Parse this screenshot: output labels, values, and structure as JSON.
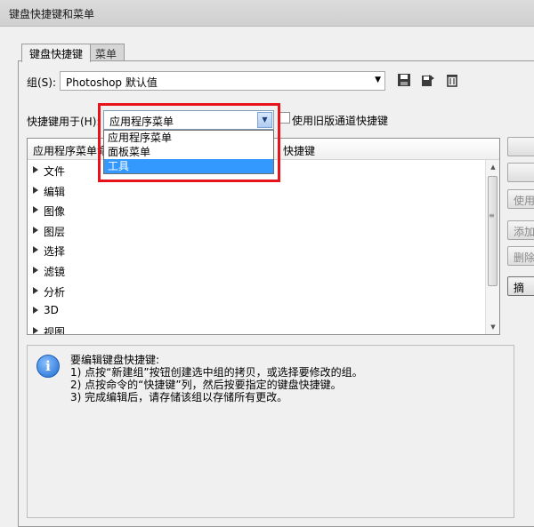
{
  "window": {
    "title": "键盘快捷键和菜单"
  },
  "tabs": [
    {
      "label": "键盘快捷键"
    },
    {
      "label": "菜单"
    }
  ],
  "group": {
    "label": "组(S):",
    "value": "Photoshop 默认值"
  },
  "shortcuts_for": {
    "label": "快捷键用于(H):",
    "value": "应用程序菜单",
    "options": [
      "应用程序菜单",
      "面板菜单",
      "工具"
    ],
    "selected": "工具"
  },
  "legacy_checkbox": {
    "label": "使用旧版通道快捷键"
  },
  "table": {
    "headers": [
      "应用程序菜单命",
      "快捷键"
    ],
    "rows": [
      "文件",
      "编辑",
      "图像",
      "图层",
      "选择",
      "滤镜",
      "分析",
      "3D",
      "视图"
    ]
  },
  "right_buttons": [
    "",
    "",
    "使用",
    "添加",
    "删除",
    "摘"
  ],
  "info": {
    "lines": [
      "要编辑键盘快捷键:",
      "1) 点按“新建组”按钮创建选中组的拷贝，或选择要修改的组。",
      "2) 点按命令的“快捷键”列，然后按要指定的键盘快捷键。",
      "3) 完成编辑后，请存储该组以存储所有更改。"
    ]
  },
  "icons": [
    "save-icon",
    "save-as-icon",
    "delete-icon",
    "info-icon"
  ],
  "colors": {
    "highlight_box": "#e8121b",
    "selected_option": "#3399ff"
  }
}
